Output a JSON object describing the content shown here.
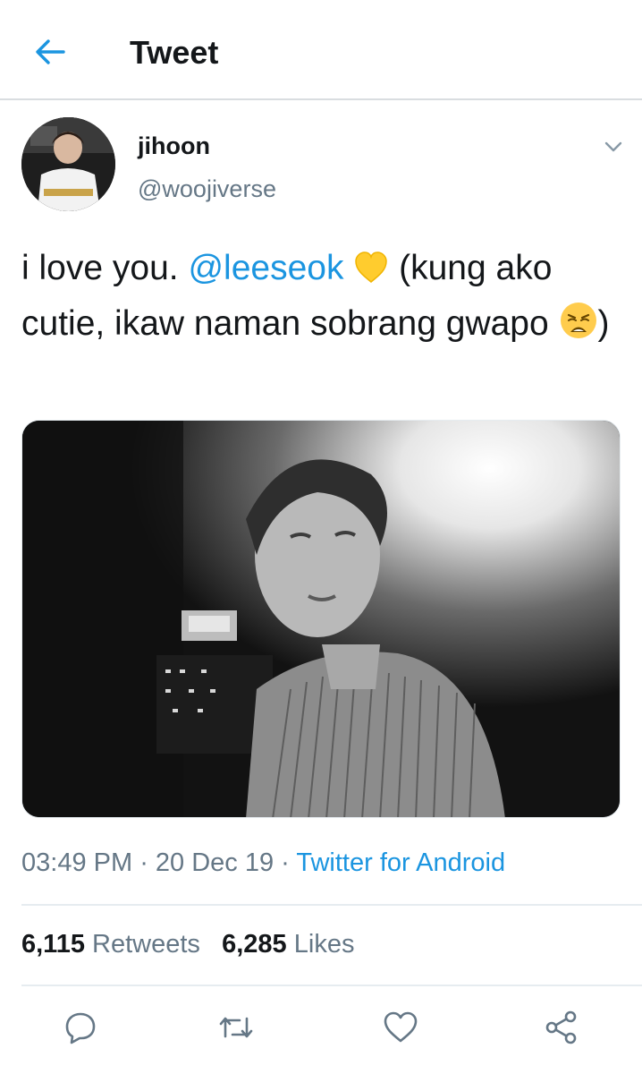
{
  "header": {
    "title": "Tweet",
    "back_icon": "back-arrow-icon"
  },
  "author": {
    "name": "jihoon",
    "handle": "@woojiverse"
  },
  "tweet": {
    "text_1": "i love you. ",
    "mention": "@leeseok",
    "emoji_heart": "yellow-heart-emoji",
    "text_2": " (kung ako cutie, ikaw naman sobrang gwapo ",
    "emoji_weary": "weary-face-emoji",
    "text_3": ")"
  },
  "meta": {
    "time": "03:49 PM",
    "sep1": " · ",
    "date": "20 Dec 19",
    "sep2": " · ",
    "source": "Twitter for Android"
  },
  "stats": {
    "retweets_count": "6,115",
    "retweets_label": "Retweets",
    "likes_count": "6,285",
    "likes_label": "Likes"
  },
  "actions": [
    "reply-icon",
    "retweet-icon",
    "like-icon",
    "share-icon"
  ],
  "colors": {
    "accent": "#1b95e0",
    "secondary": "#657786",
    "text": "#14171a",
    "border": "#e6ecf0"
  }
}
